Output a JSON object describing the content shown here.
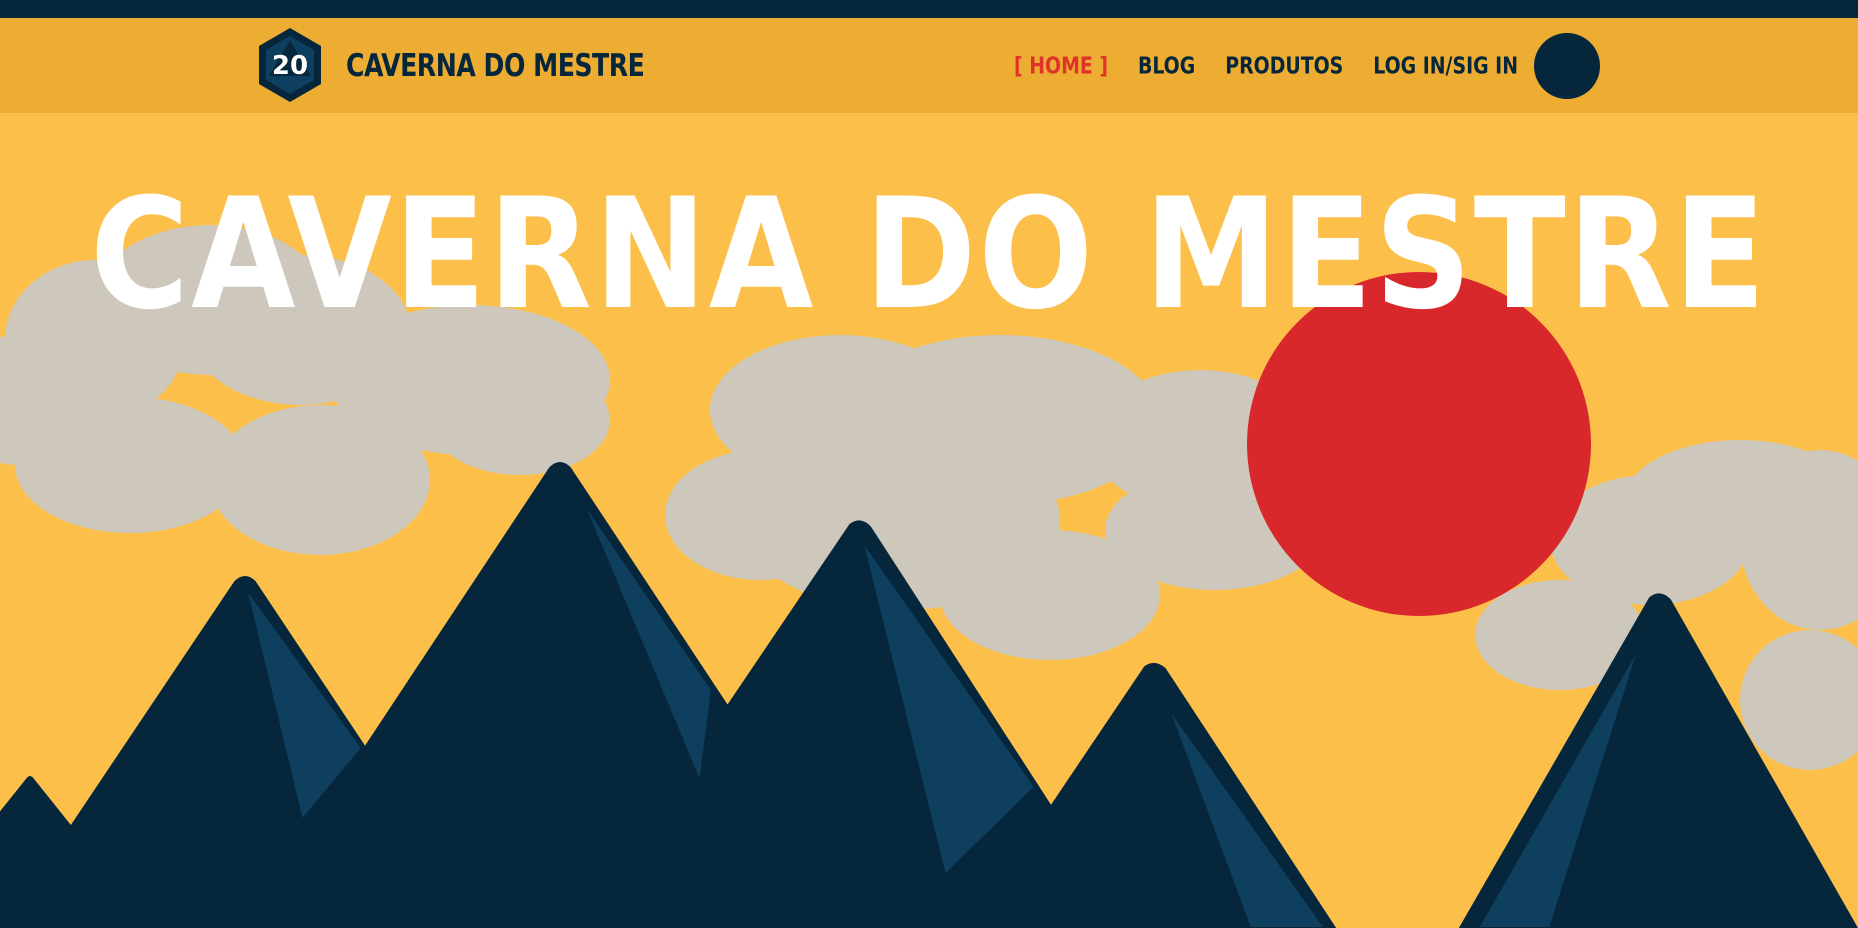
{
  "brand": {
    "logo_number": "20",
    "name": "CAVERNA DO MESTRE"
  },
  "nav": {
    "items": [
      {
        "label": "[ HOME ]",
        "active": true
      },
      {
        "label": "BLOG",
        "active": false
      },
      {
        "label": "PRODUTOS",
        "active": false
      },
      {
        "label": "LOG IN/SIG IN",
        "active": false
      }
    ]
  },
  "hero": {
    "title": "CAVERNA DO MESTRE"
  },
  "colors": {
    "background": "#fcbf4a",
    "navbar": "#edac32",
    "top_strip": "#06263b",
    "dark_navy": "#06263b",
    "mountain_highlight": "#0e3f5e",
    "cloud": "#cdc8bb",
    "sun": "#d9282b",
    "active_nav": "#e0322a",
    "hero_text": "#ffffff"
  },
  "icons": {
    "logo": "d20-dice-icon",
    "avatar": "user-avatar"
  }
}
